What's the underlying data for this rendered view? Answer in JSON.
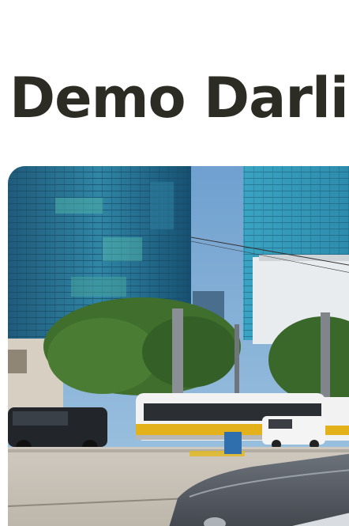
{
  "article": {
    "headline": "Demo Darlin"
  },
  "hero_image": {
    "description_label": "city-street-photo"
  },
  "colors": {
    "headline": "#2c2b24",
    "background": "#ffffff",
    "sky": "#8ab4d8",
    "tram_body": "#f2f2f2",
    "tram_stripe": "#e3b21b",
    "tree": "#3f6e2d"
  }
}
